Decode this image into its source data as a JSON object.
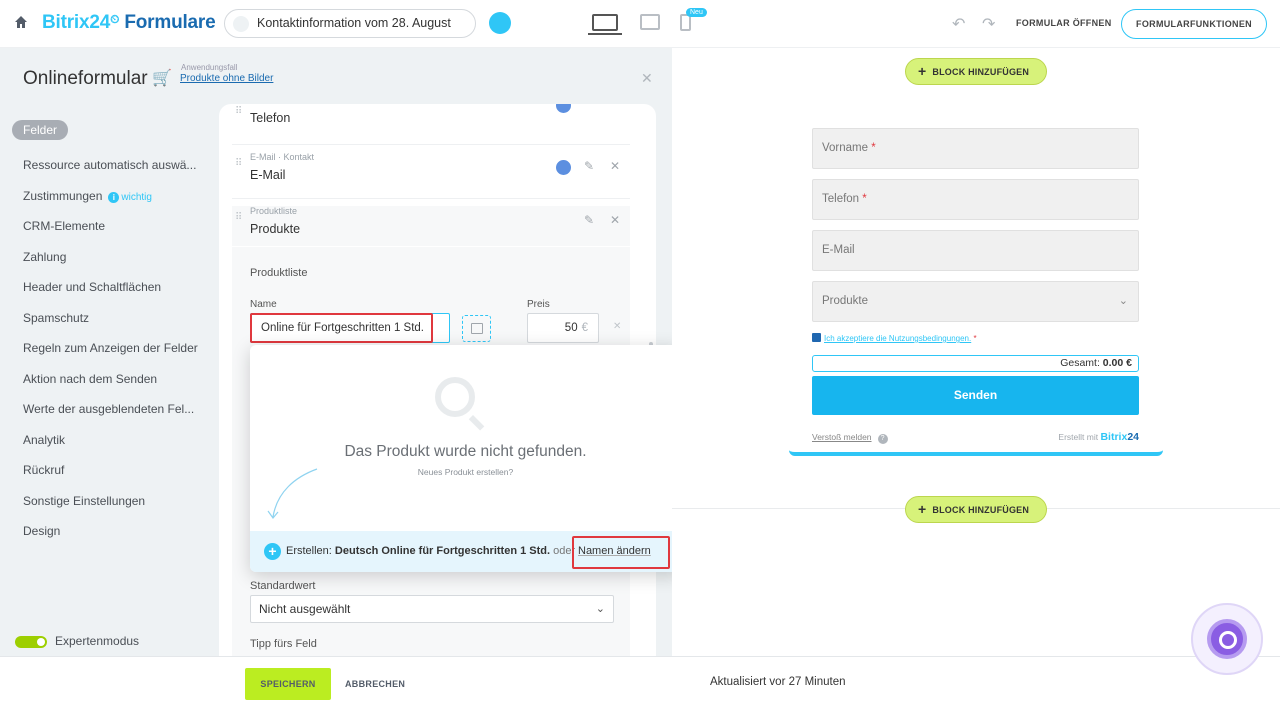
{
  "topbar": {
    "logo_brand": "Bitrix24",
    "logo_app": "Formulare",
    "form_name": "Kontaktinformation vom 28. August",
    "new_badge": "Neu",
    "open_form": "FORMULAR ÖFFNEN",
    "form_functions": "FORMULARFUNKTIONEN"
  },
  "left": {
    "title": "Onlineformular",
    "usecase_label": "Anwendungsfall",
    "usecase_value": "Produkte ohne Bilder",
    "menu": [
      "Felder",
      "Ressource automatisch auswä...",
      "Zustimmungen",
      "CRM-Elemente",
      "Zahlung",
      "Header und Schaltflächen",
      "Spamschutz",
      "Regeln zum Anzeigen der Felder",
      "Aktion nach dem Senden",
      "Werte der ausgeblendeten Fel...",
      "Analytik",
      "Rückruf",
      "Sonstige Einstellungen",
      "Design"
    ],
    "wichtig": "wichtig",
    "expert_mode": "Expertenmodus"
  },
  "fields": {
    "telefon": "Telefon",
    "email_sub": "E-Mail · Kontakt",
    "email": "E-Mail",
    "produkte_sub": "Produktliste",
    "produkte": "Produkte",
    "section_label": "Produktliste",
    "name_label": "Name",
    "price_label": "Preis",
    "name_value": "Online für Fortgeschritten 1 Std.",
    "price_value": "50",
    "currency": "€",
    "default_label": "Standardwert",
    "default_value": "Nicht ausgewählt",
    "tip_label": "Tipp fürs Feld"
  },
  "popup": {
    "title": "Das Produkt wurde nicht gefunden.",
    "subtitle": "Neues Produkt erstellen?",
    "create_prefix": "Erstellen:",
    "create_name": "Deutsch Online für Fortgeschritten 1 Std.",
    "or": "oder",
    "rename": "Namen ändern"
  },
  "bottom": {
    "save": "SPEICHERN",
    "cancel": "ABBRECHEN",
    "updated": "Aktualisiert vor 27 Minuten"
  },
  "preview": {
    "add_block": "BLOCK HINZUFÜGEN",
    "vorname": "Vorname",
    "telefon": "Telefon",
    "email": "E-Mail",
    "produkte": "Produkte",
    "terms": "Ich akzeptiere die Nutzungsbedingungen.",
    "total_label": "Gesamt:",
    "total_value": "0.00 €",
    "send": "Senden",
    "report": "Verstoß melden",
    "made_with": "Erstellt mit",
    "made_brand": "Bitrix",
    "made_num": "24"
  },
  "colors": {
    "accent": "#2fc6f6",
    "save_green": "#bbed21",
    "highlight": "#e0383e"
  }
}
